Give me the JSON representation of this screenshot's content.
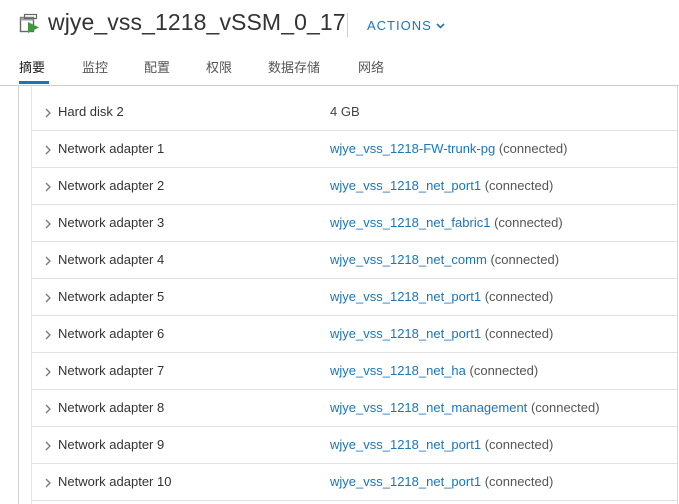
{
  "header": {
    "title": "wjye_vss_1218_vSSM_0_17",
    "actions_label": "ACTIONS",
    "vm_icon": "vm-icon",
    "accent": "#1b75bb"
  },
  "tabs": [
    {
      "label": "摘要",
      "active": true
    },
    {
      "label": "监控"
    },
    {
      "label": "配置"
    },
    {
      "label": "权限"
    },
    {
      "label": "数据存储"
    },
    {
      "label": "网络"
    }
  ],
  "hardware_rows": [
    {
      "name": "Hard disk 2",
      "value": "4 GB"
    },
    {
      "name": "Network adapter 1",
      "network": "wjye_vss_1218-FW-trunk-pg",
      "status": "(connected)"
    },
    {
      "name": "Network adapter 2",
      "network": "wjye_vss_1218_net_port1",
      "status": "(connected)"
    },
    {
      "name": "Network adapter 3",
      "network": "wjye_vss_1218_net_fabric1",
      "status": "(connected)"
    },
    {
      "name": "Network adapter 4",
      "network": "wjye_vss_1218_net_comm",
      "status": "(connected)"
    },
    {
      "name": "Network adapter 5",
      "network": "wjye_vss_1218_net_port1",
      "status": "(connected)"
    },
    {
      "name": "Network adapter 6",
      "network": "wjye_vss_1218_net_port1",
      "status": "(connected)"
    },
    {
      "name": "Network adapter 7",
      "network": "wjye_vss_1218_net_ha",
      "status": "(connected)"
    },
    {
      "name": "Network adapter 8",
      "network": "wjye_vss_1218_net_management",
      "status": "(connected)"
    },
    {
      "name": "Network adapter 9",
      "network": "wjye_vss_1218_net_port1",
      "status": "(connected)"
    },
    {
      "name": "Network adapter 10",
      "network": "wjye_vss_1218_net_port1",
      "status": "(connected)"
    }
  ]
}
